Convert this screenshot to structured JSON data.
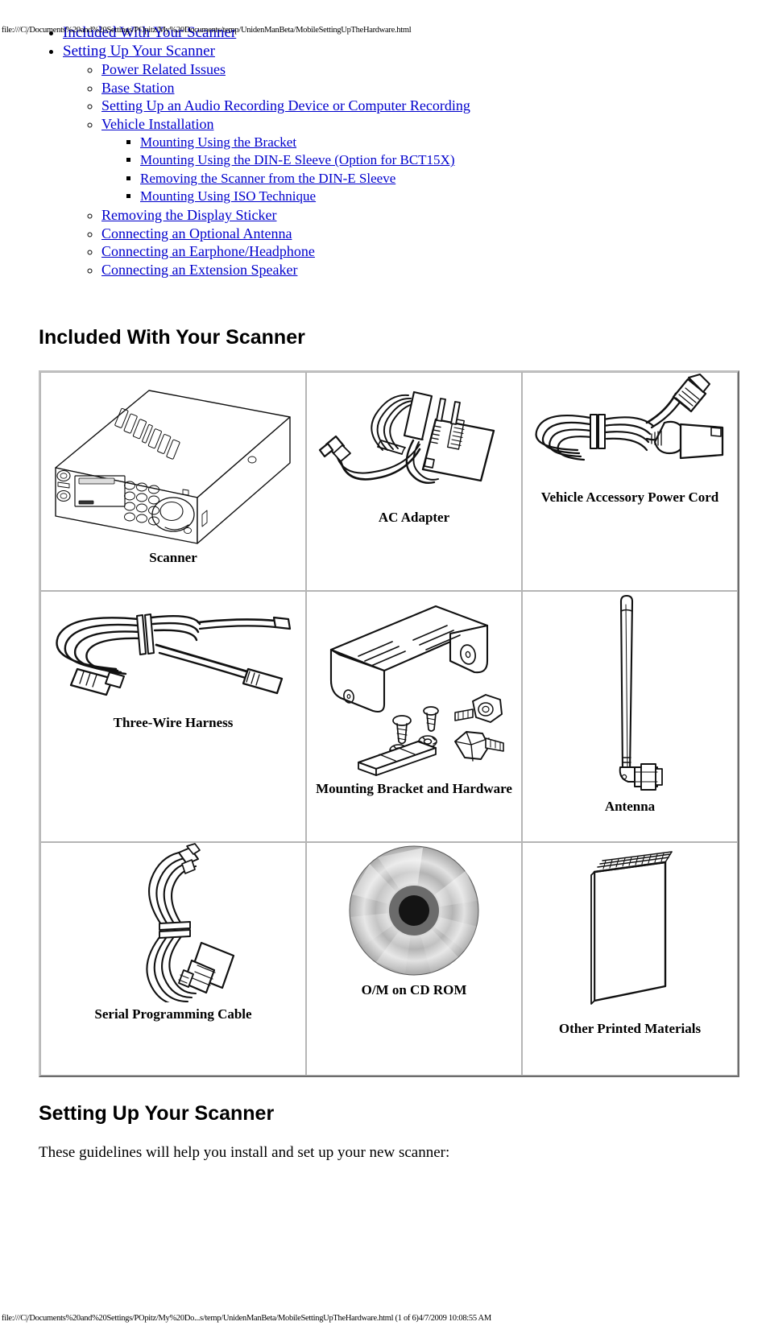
{
  "browser_print": {
    "header_url": "file:///C|/Documents%20and%20Settings/POpitz/My%20Documents/temp/UnidenManBeta/MobileSettingUpTheHardware.html",
    "footer_url": "file:///C|/Documents%20and%20Settings/POpitz/My%20Do...s/temp/UnidenManBeta/MobileSettingUpTheHardware.html (1 of 6)4/7/2009 10:08:55 AM"
  },
  "toc": {
    "items": [
      {
        "label": "Included With Your Scanner",
        "children": []
      },
      {
        "label": "Setting Up Your Scanner",
        "children": [
          {
            "label": "Power Related Issues",
            "children": []
          },
          {
            "label": "Base Station",
            "children": []
          },
          {
            "label": "Setting Up an Audio Recording Device or Computer Recording",
            "children": []
          },
          {
            "label": "Vehicle Installation",
            "children": [
              {
                "label": "Mounting Using the Bracket"
              },
              {
                "label": "Mounting Using the DIN-E Sleeve (Option for BCT15X)"
              },
              {
                "label": "Removing the Scanner from the DIN-E Sleeve"
              },
              {
                "label": "Mounting Using ISO Technique"
              }
            ]
          },
          {
            "label": "Removing the Display Sticker",
            "children": []
          },
          {
            "label": "Connecting an Optional Antenna",
            "children": []
          },
          {
            "label": "Connecting an Earphone/Headphone",
            "children": []
          },
          {
            "label": "Connecting an Extension Speaker",
            "children": []
          }
        ]
      }
    ]
  },
  "sections": {
    "included": {
      "heading": "Included With Your Scanner",
      "items": [
        {
          "caption": "Scanner",
          "icon": "scanner-illustration"
        },
        {
          "caption": "AC Adapter",
          "icon": "ac-adapter-illustration"
        },
        {
          "caption": "Vehicle Accessory Power Cord",
          "icon": "vehicle-power-cord-illustration"
        },
        {
          "caption": "Three-Wire Harness",
          "icon": "three-wire-harness-illustration"
        },
        {
          "caption": "Mounting Bracket and Hardware",
          "icon": "mounting-bracket-illustration"
        },
        {
          "caption": "Antenna",
          "icon": "antenna-illustration"
        },
        {
          "caption": "Serial Programming Cable",
          "icon": "serial-cable-illustration"
        },
        {
          "caption": "O/M on CD ROM",
          "icon": "cd-rom-illustration"
        },
        {
          "caption": "Other Printed Materials",
          "icon": "printed-materials-illustration"
        }
      ]
    },
    "setup": {
      "heading": "Setting Up Your Scanner",
      "intro": "These guidelines will help you install and set up your new scanner:"
    }
  },
  "colors": {
    "link": "#0000cc",
    "text": "#000000",
    "table_border": "#b5b5b5",
    "table_outer_border": "#c0c0c0",
    "cd_silver": "#c8c8c8"
  }
}
